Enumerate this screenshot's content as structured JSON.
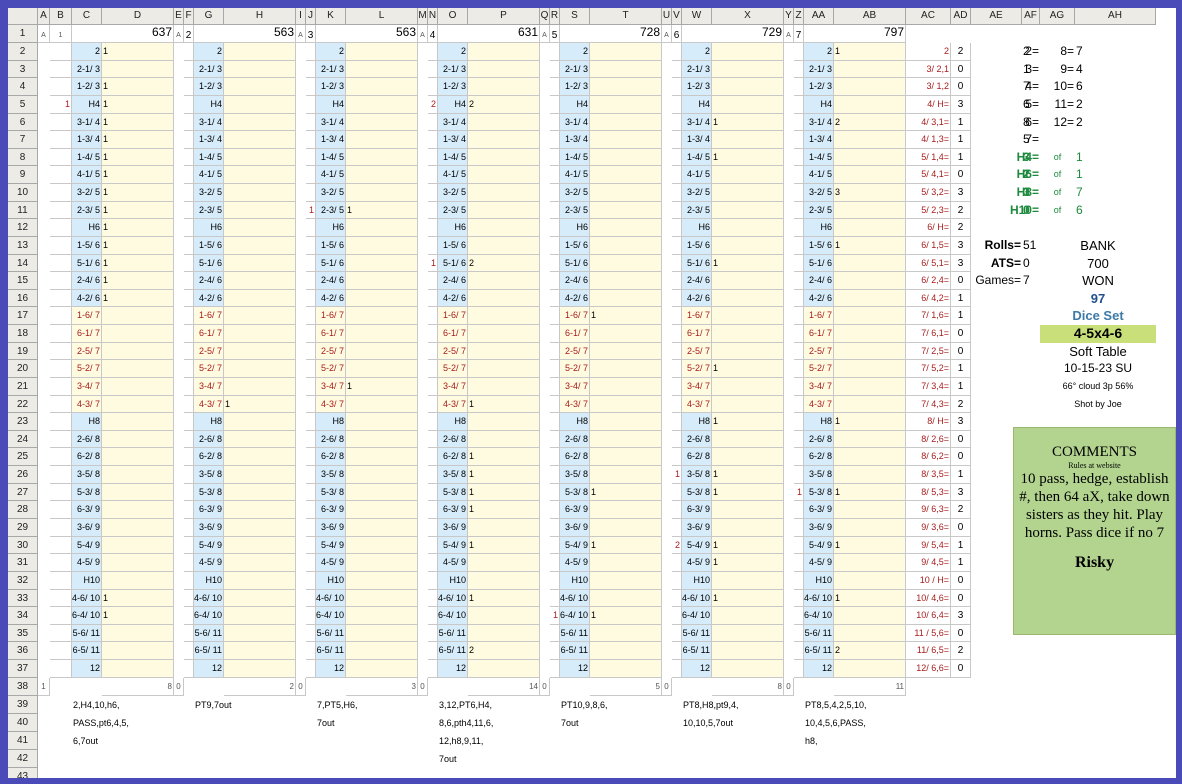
{
  "columns": [
    "A",
    "B",
    "C",
    "D",
    "E",
    "F",
    "G",
    "H",
    "I",
    "J",
    "K",
    "L",
    "M",
    "N",
    "O",
    "P",
    "Q",
    "R",
    "S",
    "T",
    "U",
    "V",
    "W",
    "X",
    "Y",
    "Z",
    "AA",
    "AB",
    "AC",
    "AD",
    "AE",
    "AF",
    "AG",
    "AH"
  ],
  "rows": [
    "1",
    "2",
    "3",
    "4",
    "5",
    "6",
    "7",
    "8",
    "9",
    "10",
    "11",
    "12",
    "13",
    "14",
    "15",
    "16",
    "17",
    "18",
    "19",
    "20",
    "21",
    "22",
    "23",
    "24",
    "25",
    "26",
    "27",
    "28",
    "29",
    "30",
    "31",
    "32",
    "33",
    "34",
    "35",
    "36",
    "37",
    "38",
    "39",
    "40",
    "41",
    "42",
    "43"
  ],
  "combos": [
    "2",
    "2-1/ 3",
    "1-2/ 3",
    "H4",
    "3-1/ 4",
    "1-3/ 4",
    "1-4/ 5",
    "4-1/ 5",
    "3-2/ 5",
    "2-3/ 5",
    "H6",
    "1-5/ 6",
    "5-1/ 6",
    "2-4/ 6",
    "4-2/ 6",
    "1-6/ 7",
    "6-1/ 7",
    "2-5/ 7",
    "5-2/ 7",
    "3-4/ 7",
    "4-3/ 7",
    "H8",
    "2-6/ 8",
    "6-2/ 8",
    "3-5/ 8",
    "5-3/ 8",
    "6-3/ 9",
    "3-6/ 9",
    "5-4/ 9",
    "4-5/ 9",
    "H10",
    "4-6/ 10",
    "6-4/ 10",
    "5-6/ 11",
    "6-5/ 11",
    "12"
  ],
  "sessions": [
    {
      "num": "1",
      "pre": "A",
      "score": "637",
      "first_col": "1",
      "last_col": "8",
      "hits": {
        "0": "1",
        "2": "1",
        "3": "1",
        "4": "1",
        "5": "1",
        "6": "1",
        "7": "1",
        "8": "1",
        "9": "1",
        "10": "1",
        "11": "1",
        "12": "1",
        "13": "1",
        "14": "1",
        "31": "1",
        "32": "1"
      },
      "left": {
        "3": "1"
      },
      "summary": [
        "2,H4,10,h6,",
        "PASS,pt6,4,5,",
        "6,7out"
      ]
    },
    {
      "num": "2",
      "pre": "A",
      "score": "563",
      "first_col": "0",
      "last_col": "2",
      "hits": {
        "20": "1"
      },
      "left": {},
      "summary": [
        "PT9,7out"
      ]
    },
    {
      "num": "3",
      "pre": "A",
      "score": "563",
      "first_col": "0",
      "last_col": "3",
      "hits": {
        "9": "1",
        "19": "1"
      },
      "left": {
        "9": "1"
      },
      "summary": [
        "7,PT5,H6,",
        "7out"
      ]
    },
    {
      "num": "4",
      "pre": "A",
      "score": "631",
      "first_col": "0",
      "last_col": "14",
      "hits": {
        "3": "2",
        "12": "2",
        "20": "1",
        "23": "1",
        "24": "1",
        "25": "1",
        "26": "1",
        "28": "1",
        "31": "1",
        "34": "2"
      },
      "left": {
        "3": "2",
        "12": "1"
      },
      "summary": [
        "3,12,PT6,H4,",
        "8,6,pth4,11,6,",
        "12,h8,9,11,",
        "7out"
      ]
    },
    {
      "num": "5",
      "pre": "A",
      "score": "728",
      "first_col": "0",
      "last_col": "5",
      "hits": {
        "15": "1",
        "25": "1",
        "28": "1",
        "32": "1"
      },
      "left": {
        "32": "1"
      },
      "summary": [
        "PT10,9,8,6,",
        "7out"
      ]
    },
    {
      "num": "6",
      "pre": "A",
      "score": "729",
      "first_col": "0",
      "last_col": "8",
      "hits": {
        "4": "1",
        "6": "1",
        "12": "1",
        "18": "1",
        "21": "1",
        "24": "1",
        "25": "1",
        "28": "1",
        "29": "1",
        "31": "1"
      },
      "left": {
        "24": "1",
        "28": "2"
      },
      "summary": [
        "PT8,H8,pt9,4,",
        "10,10,5,7out"
      ]
    },
    {
      "num": "7",
      "pre": "A",
      "score": "797",
      "first_col": "0",
      "last_col": "11",
      "hits": {
        "0": "1",
        "4": "2",
        "8": "3",
        "11": "1",
        "21": "1",
        "25": "1",
        "28": "1",
        "31": "1",
        "34": "2"
      },
      "left": {
        "25": "1"
      },
      "summary": [
        "PT8,5,4,2,5,10,",
        "10,4,5,6,PASS,",
        "h8,"
      ]
    }
  ],
  "ac_labels": [
    "2",
    "3/ 2,1",
    "3/ 1,2",
    "4/ H=",
    "4/ 3,1=",
    "4/ 1,3=",
    "5/ 1,4=",
    "5/ 4,1=",
    "5/ 3,2=",
    "5/ 2,3=",
    "6/ H=",
    "6/ 1,5=",
    "6/ 5,1=",
    "6/ 2,4=",
    "6/ 4,2=",
    "7/ 1,6=",
    "7/ 6,1=",
    "7/ 2,5=",
    "7/ 5,2=",
    "7/ 3,4=",
    "7/ 4,3=",
    "8/ H=",
    "8/ 2,6=",
    "8/ 6,2=",
    "8/ 3,5=",
    "8/ 5,3=",
    "9/ 6,3=",
    "9/ 3,6=",
    "9/ 5,4=",
    "9/ 4,5=",
    "10 / H=",
    "10/ 4,6=",
    "10/ 6,4=",
    "11 / 5,6=",
    "11/ 6,5=",
    "12/ 6,6="
  ],
  "ad_values": [
    "2",
    "0",
    "0",
    "3",
    "1",
    "1",
    "1",
    "0",
    "3",
    "2",
    "2",
    "3",
    "3",
    "0",
    "1",
    "1",
    "0",
    "0",
    "1",
    "1",
    "2",
    "3",
    "0",
    "0",
    "1",
    "3",
    "2",
    "0",
    "1",
    "1",
    "0",
    "0",
    "3",
    "0",
    "2",
    "0"
  ],
  "totals": [
    {
      "label": "2= ",
      "value": "2",
      "label2": "8= ",
      "value2": "7"
    },
    {
      "label": "3= ",
      "value": "1",
      "label2": "9= ",
      "value2": "4"
    },
    {
      "label": "4= ",
      "value": "7",
      "label2": "10= ",
      "value2": "6"
    },
    {
      "label": "5= ",
      "value": "6",
      "label2": "11= ",
      "value2": "2"
    },
    {
      "label": "6= ",
      "value": "8",
      "label2": "12= ",
      "value2": "2"
    },
    {
      "label": "7= ",
      "value": "5"
    }
  ],
  "hardways": [
    {
      "label": "H4= ",
      "value": "3",
      "of": "of",
      "total": "1"
    },
    {
      "label": "H6= ",
      "value": "2",
      "of": "of",
      "total": "1"
    },
    {
      "label": "H8= ",
      "value": "3",
      "of": "of",
      "total": "7"
    },
    {
      "label": "H10= ",
      "value": "0",
      "of": "of",
      "total": "6"
    }
  ],
  "stats": [
    {
      "label": "Rolls=",
      "value": "51"
    },
    {
      "label": "ATS=",
      "value": "0"
    },
    {
      "label": "Games=",
      "value": "7"
    }
  ],
  "bank": {
    "label": "BANK",
    "amount": "700",
    "won_label": "WON",
    "won": "97"
  },
  "dice": {
    "label": "Dice Set",
    "value": "4-5x4-6",
    "table": "Soft Table",
    "date": "10-15-23 SU",
    "weather": "66° cloud 3p 56%",
    "shooter": "Shot by Joe"
  },
  "comments": {
    "title": "COMMENTS",
    "subtitle": "Rules at website",
    "body": "10 pass, hedge, establish #, then 64 aX, take down sisters as they hit. Play horns. Pass dice if no 7",
    "tag": "Risky"
  },
  "colors": {
    "combo_bg": "#d6ecfa",
    "count_bg": "#fffbe0",
    "seven_text": "#a81c1c",
    "hardway_text": "#1c8a3c",
    "won_text": "#22508a",
    "dice_bg": "#c9e07a",
    "note_bg": "#b2d48f",
    "frame": "#4a4ab8"
  }
}
